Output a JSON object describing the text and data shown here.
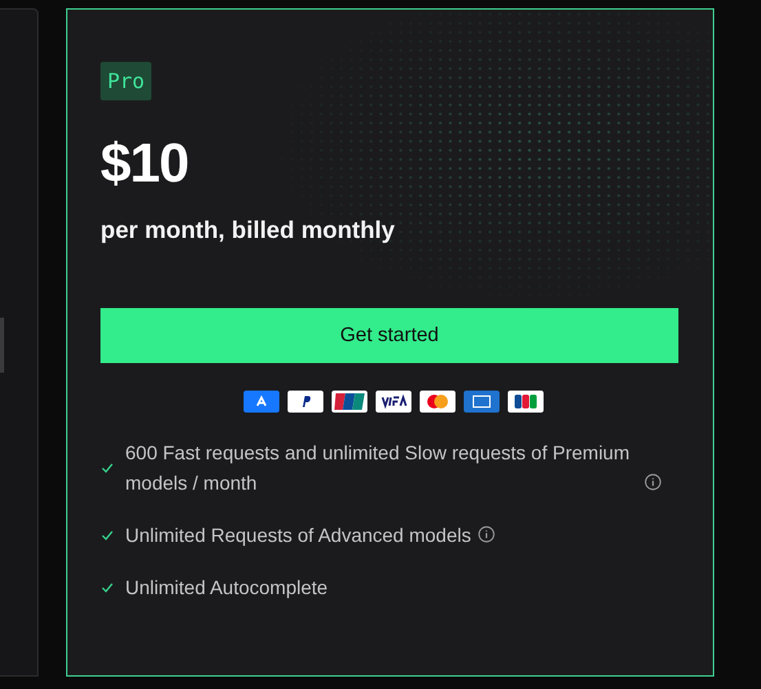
{
  "plan": {
    "badge": "Pro",
    "price": "$10",
    "period": "per month, billed monthly",
    "cta": "Get started",
    "payment_methods": [
      {
        "kind": "alipay"
      },
      {
        "kind": "paypal"
      },
      {
        "kind": "unionpay"
      },
      {
        "kind": "visa"
      },
      {
        "kind": "mastercard"
      },
      {
        "kind": "amex"
      },
      {
        "kind": "jcb"
      }
    ],
    "features": [
      {
        "text": "600 Fast requests and unlimited Slow requests of Premium models / month",
        "info": true
      },
      {
        "text": "Unlimited Requests of Advanced models",
        "info": true
      },
      {
        "text": "Unlimited Autocomplete",
        "info": false
      }
    ]
  }
}
